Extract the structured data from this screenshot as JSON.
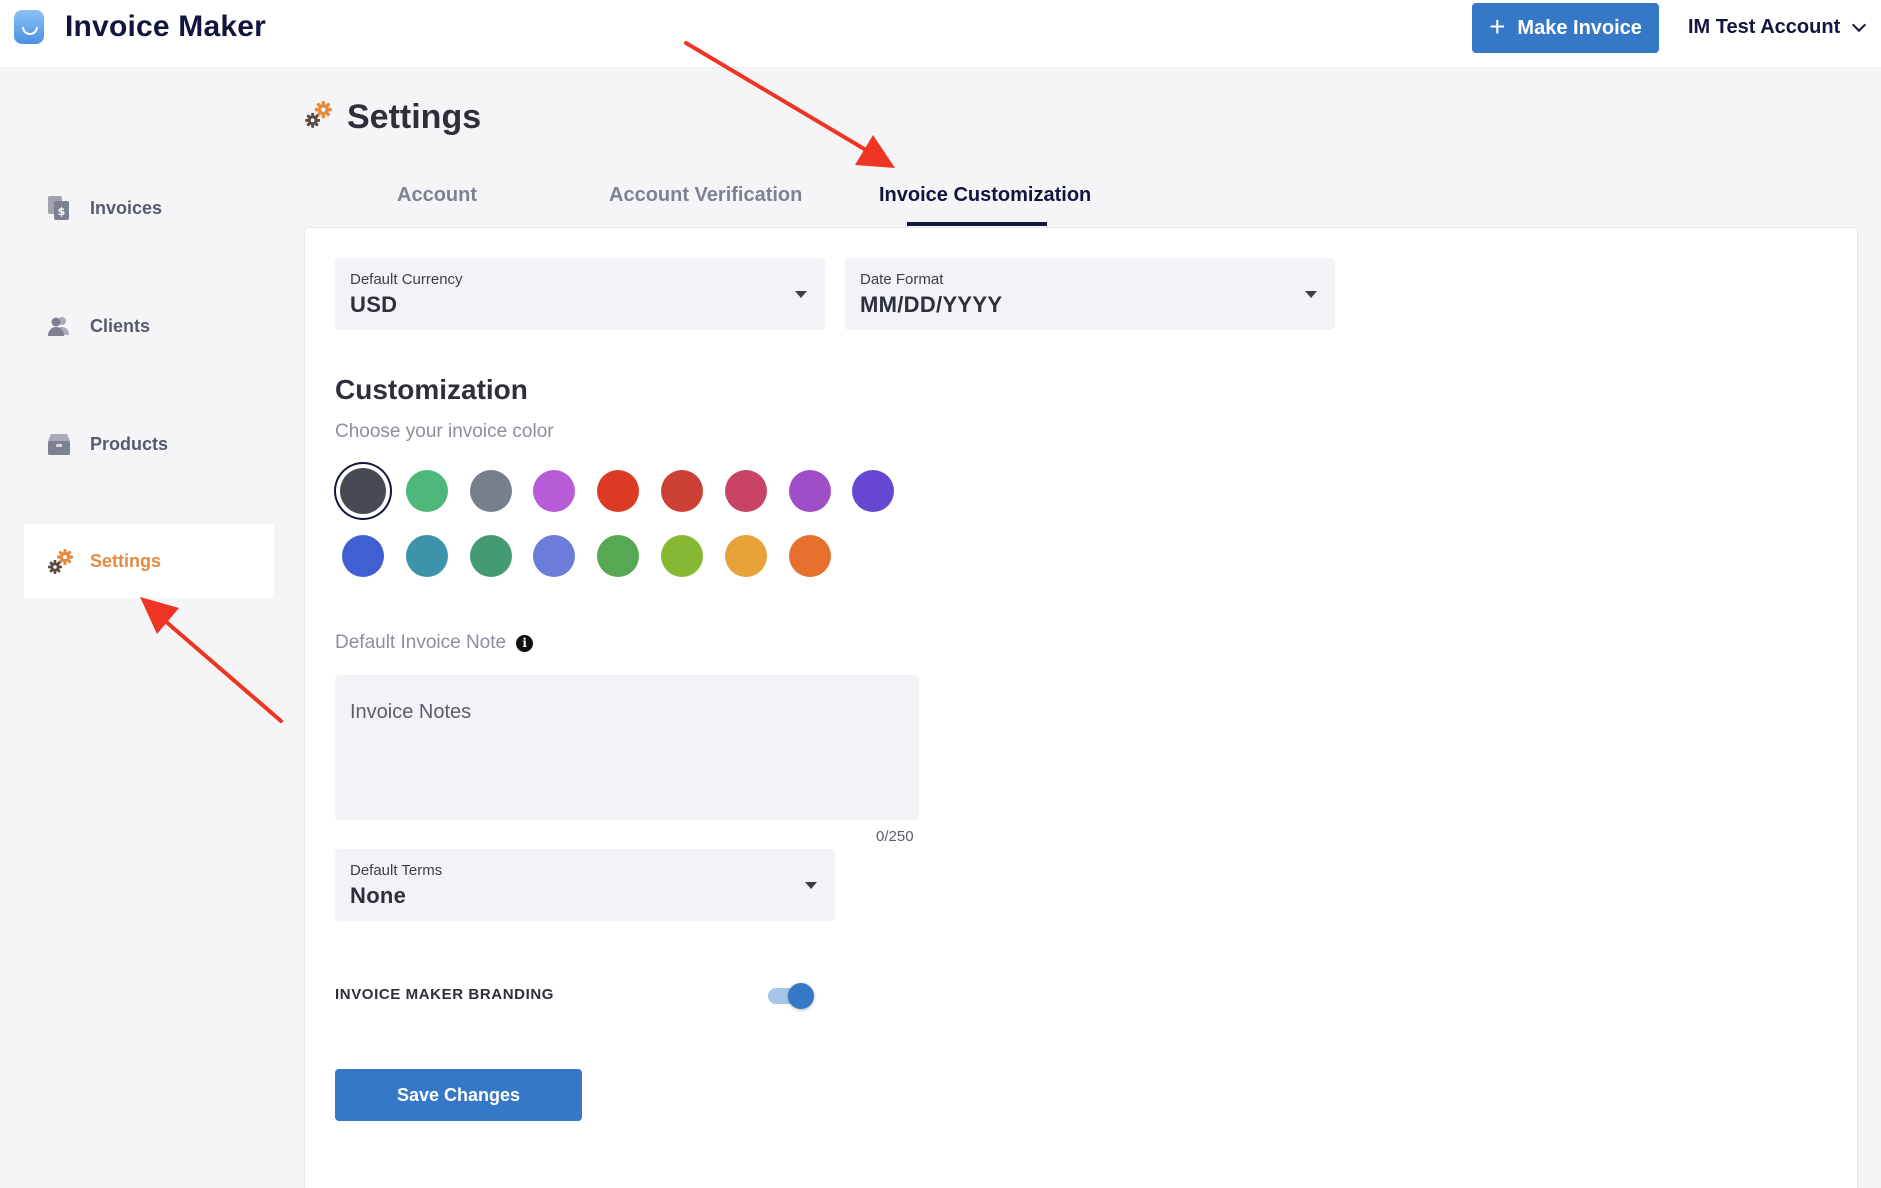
{
  "header": {
    "app_title": "Invoice Maker",
    "make_invoice_label": "Make Invoice",
    "make_invoice_icon": "plus-icon",
    "account_label": "IM Test Account"
  },
  "sidebar": {
    "items": [
      {
        "label": "Invoices",
        "icon": "invoice-dollar-icon",
        "active": false
      },
      {
        "label": "Clients",
        "icon": "users-icon",
        "active": false
      },
      {
        "label": "Products",
        "icon": "box-icon",
        "active": false
      },
      {
        "label": "Settings",
        "icon": "gears-icon",
        "active": true
      }
    ]
  },
  "page": {
    "title": "Settings",
    "tabs": [
      {
        "label": "Account",
        "active": false
      },
      {
        "label": "Account Verification",
        "active": false
      },
      {
        "label": "Invoice Customization",
        "active": true
      }
    ]
  },
  "form": {
    "currency": {
      "label": "Default Currency",
      "value": "USD"
    },
    "date_format": {
      "label": "Date Format",
      "value": "MM/DD/YYYY"
    },
    "customization_title": "Customization",
    "color_prompt": "Choose your invoice color",
    "colors": [
      "#474a52",
      "#4db87a",
      "#777f8b",
      "#b75bd6",
      "#dd3a25",
      "#cc4036",
      "#c94365",
      "#a04ec8",
      "#6547d1",
      "#3f5fd3",
      "#3c93aa",
      "#449b72",
      "#6c7cdb",
      "#56a852",
      "#86b834",
      "#e8a23a",
      "#e8702f"
    ],
    "selected_color": "#474a52",
    "note_label": "Default Invoice Note",
    "note_placeholder": "Invoice Notes",
    "note_counter": "0/250",
    "terms": {
      "label": "Default Terms",
      "value": "None"
    },
    "branding_label": "INVOICE MAKER BRANDING",
    "branding_enabled": true,
    "save_label": "Save Changes"
  },
  "accent_colors": {
    "primary": "#3578c7",
    "active_nav": "#e38b3f",
    "annotation_arrow": "#ee3524"
  }
}
